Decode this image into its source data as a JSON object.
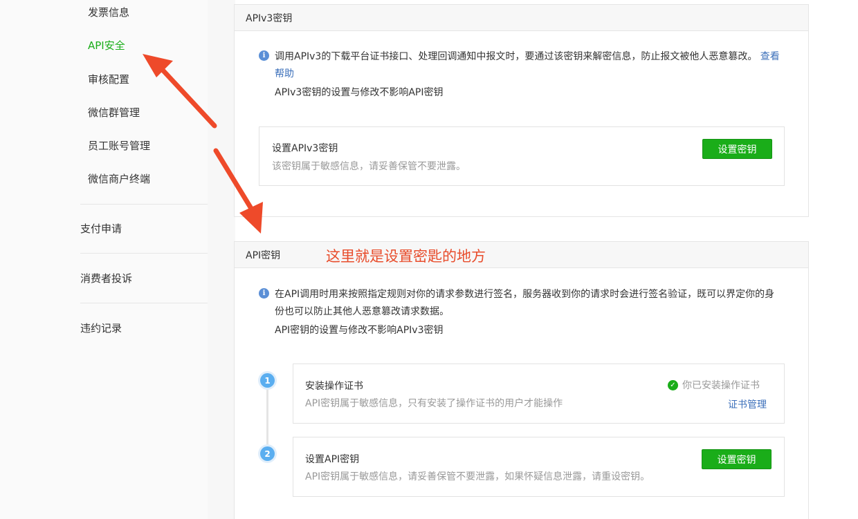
{
  "sidebar": {
    "sub_items": [
      "发票信息",
      "API安全",
      "审核配置",
      "微信群管理",
      "员工账号管理",
      "微信商户终端"
    ],
    "active_index": 1,
    "groups": [
      "支付申请",
      "消费者投诉",
      "违约记录"
    ]
  },
  "apiv3_section": {
    "title": "APIv3密钥",
    "note": "调用APIv3的下载平台证书接口、处理回调通知中报文时，要通过该密钥来解密信息，防止报文被他人恶意篡改。",
    "help_link": "查看帮助",
    "sub_note": "APIv3密钥的设置与修改不影响API密钥",
    "card": {
      "title": "设置APIv3密钥",
      "desc": "该密钥属于敏感信息，请妥善保管不要泄露。",
      "button": "设置密钥"
    }
  },
  "api_section": {
    "title": "API密钥",
    "annotation": "这里就是设置密匙的地方",
    "note": "在API调用时用来按照指定规则对你的请求参数进行签名，服务器收到你的请求时会进行签名验证，既可以界定你的身份也可以防止其他人恶意篡改请求数据。",
    "sub_note": "API密钥的设置与修改不影响APIv3密钥",
    "steps": [
      {
        "number": "1",
        "title": "安装操作证书",
        "desc": "API密钥属于敏感信息，只有安装了操作证书的用户才能操作",
        "status": "你已安装操作证书",
        "link": "证书管理"
      },
      {
        "number": "2",
        "title": "设置API密钥",
        "desc": "API密钥属于敏感信息，请妥善保管不要泄露，如果怀疑信息泄露，请重设密钥。",
        "button": "设置密钥"
      }
    ]
  },
  "colors": {
    "accent_green": "#1aad19",
    "link_blue": "#3b6fba",
    "annotation_red": "#e84c2b",
    "step_blue": "#5aaef0"
  },
  "icons": {
    "info": "info-icon",
    "check": "check-circle-icon",
    "arrow": "annotation-arrow-icon"
  }
}
